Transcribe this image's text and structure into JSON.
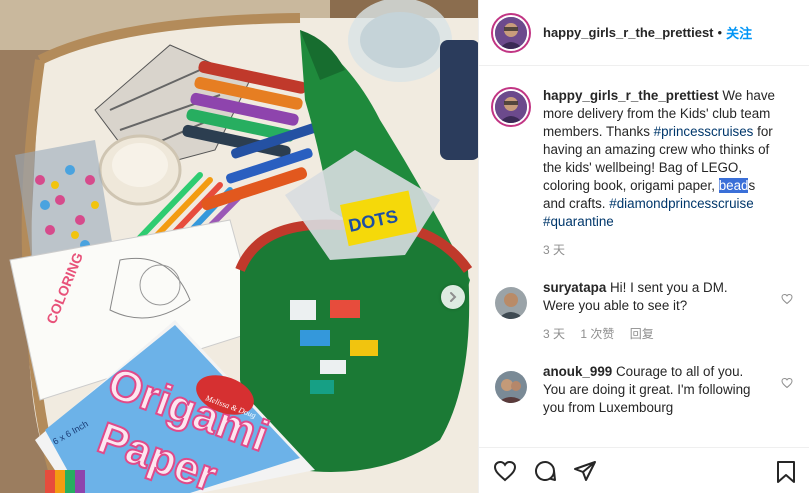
{
  "post": {
    "username": "happy_girls_r_the_prettiest",
    "separator": "•",
    "follow_label": "关注"
  },
  "caption": {
    "username": "happy_girls_r_the_prettiest",
    "text_1": "We have more delivery from the Kids' club team members. Thanks",
    "tag_1": "#princesscruises",
    "text_2": "for having an amazing crew who thinks of the kids' wellbeing! Bag of LEGO, coloring book, origami paper,",
    "highlight": "bead",
    "text_3": "s and crafts.",
    "tag_2": "#diamondprincesscruise",
    "tag_3": "#quarantine",
    "time": "3 天"
  },
  "comments": [
    {
      "username": "suryatapa",
      "text": "Hi! I sent you a DM. Were you able to see it?",
      "time": "3 天",
      "likes": "1 次赞",
      "reply": "回复"
    },
    {
      "username": "anouk_999",
      "text": "Courage to all of you. You are doing it great. I'm following you from Luxembourg"
    }
  ],
  "photo": {
    "book_title_1": "Origami",
    "book_title_2": "Paper",
    "brand": "Melissa & Doug",
    "size_text": "6 x 6 Inch",
    "coloring_text": "COLORING",
    "candy_box": "DOTS"
  },
  "colors": {
    "accent": "#0095f6",
    "ring": "#c13584",
    "tag": "#00376b",
    "muted": "#8e8e8e"
  },
  "icons": [
    "chevron-right-icon",
    "heart-icon",
    "comment-icon",
    "share-icon",
    "bookmark-icon"
  ]
}
